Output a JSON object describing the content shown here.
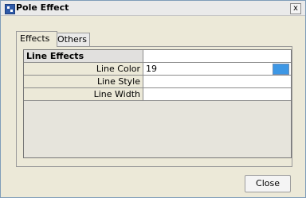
{
  "window": {
    "title": "Pole Effect",
    "close_glyph": "x"
  },
  "tabs": [
    {
      "label": "Effects",
      "selected": true
    },
    {
      "label": "Others",
      "selected": false
    }
  ],
  "properties": {
    "header": "Line Effects",
    "rows": [
      {
        "label": "Line Color",
        "value": "19",
        "color_swatch": "#3d97e5"
      },
      {
        "label": "Line Style",
        "value": ""
      },
      {
        "label": "Line Width",
        "value": ""
      }
    ]
  },
  "buttons": {
    "close_label": "Close"
  },
  "colors": {
    "window_bg": "#ece9d8",
    "accent": "#3d97e5"
  }
}
